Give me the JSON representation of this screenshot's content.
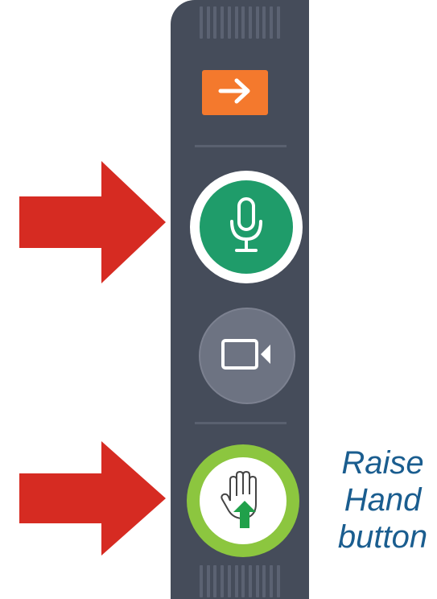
{
  "toolbar": {
    "buttons": [
      {
        "name": "collapse-panel",
        "icon": "arrow-right-icon",
        "color": "#f4792d"
      },
      {
        "name": "microphone",
        "icon": "microphone-icon",
        "state": "on",
        "color": "#1f9c6a"
      },
      {
        "name": "camera",
        "icon": "video-camera-icon",
        "state": "off",
        "color": "#6d7382"
      },
      {
        "name": "raise-hand",
        "icon": "raise-hand-icon",
        "highlight_color": "#8cc63f"
      }
    ]
  },
  "annotation": {
    "callout_color": "#d62b22",
    "caption_lines": [
      "Raise",
      "Hand",
      "button"
    ],
    "caption_color": "#1a5d8f"
  }
}
